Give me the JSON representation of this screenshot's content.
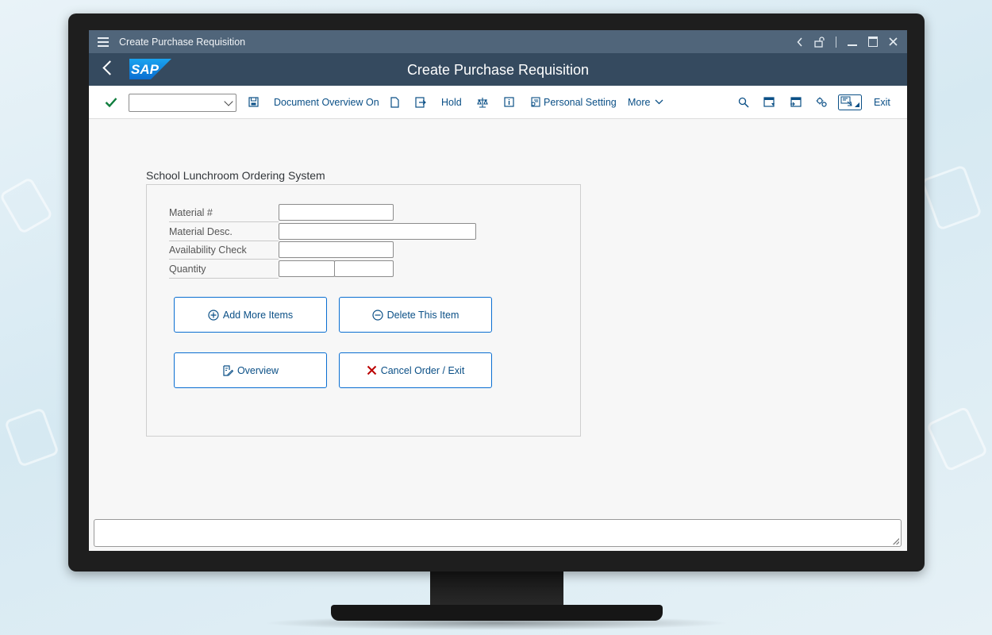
{
  "window": {
    "title": "Create Purchase Requisition"
  },
  "shell": {
    "title": "Create Purchase Requisition",
    "logo_text": "SAP"
  },
  "toolbar": {
    "command_field_value": "",
    "document_overview_label": "Document Overview On",
    "hold_label": "Hold",
    "personal_setting_label": "Personal Setting",
    "more_label": "More",
    "exit_label": "Exit"
  },
  "form": {
    "title": "School Lunchroom Ordering System",
    "fields": [
      {
        "label": "Material #",
        "value": ""
      },
      {
        "label": "Material Desc.",
        "value": ""
      },
      {
        "label": "Availability Check",
        "value": ""
      },
      {
        "label": "Quantity",
        "value": "",
        "unit": ""
      }
    ],
    "buttons": {
      "add_more": "Add More Items",
      "delete_item": "Delete This Item",
      "overview": "Overview",
      "cancel_exit": "Cancel Order / Exit"
    }
  },
  "statusbar": {
    "message": ""
  },
  "colors": {
    "shell_bar": "#354a5f",
    "title_bar": "#50657a",
    "link_blue": "#0a4f86",
    "button_border": "#0a6ed1",
    "check_green": "#107e3e",
    "cancel_red": "#bb0000"
  }
}
